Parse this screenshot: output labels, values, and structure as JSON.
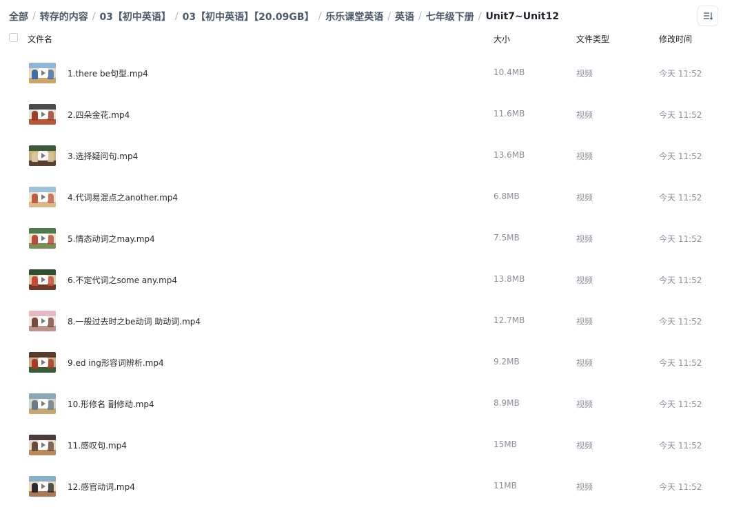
{
  "breadcrumb": [
    "全部",
    "转存的内容",
    "03【初中英语】",
    "03【初中英语】【20.09GB】",
    "乐乐课堂英语",
    "英语",
    "七年级下册",
    "Unit7~Unit12"
  ],
  "breadcrumb_separator": "/",
  "toolbar": {
    "sort_icon": "sort-list-icon"
  },
  "columns": {
    "name": "文件名",
    "size": "大小",
    "type": "文件类型",
    "time": "修改时间"
  },
  "files": [
    {
      "name": "1.there be句型.mp4",
      "size": "10.4MB",
      "type": "视频",
      "time": "今天 11:52",
      "thumb": {
        "top": "#8fb6d6",
        "mid": "#e9dcc0",
        "bot": "#c9a46e",
        "fig": "#3b6fa8"
      }
    },
    {
      "name": "2.四朵金花.mp4",
      "size": "11.6MB",
      "type": "视频",
      "time": "今天 11:52",
      "thumb": {
        "top": "#4a4a4a",
        "mid": "#e8e2d6",
        "bot": "#b85a3a",
        "fig": "#9b3d2a"
      }
    },
    {
      "name": "3.选择疑问句.mp4",
      "size": "13.6MB",
      "type": "视频",
      "time": "今天 11:52",
      "thumb": {
        "top": "#3a5a3a",
        "mid": "#c9b27a",
        "bot": "#5a4030",
        "fig": "#d8c7a0"
      }
    },
    {
      "name": "4.代词易混点之another.mp4",
      "size": "6.8MB",
      "type": "视频",
      "time": "今天 11:52",
      "thumb": {
        "top": "#9ec3d8",
        "mid": "#efe4cf",
        "bot": "#d9b98a",
        "fig": "#c25a48"
      }
    },
    {
      "name": "5.情态动词之may.mp4",
      "size": "7.5MB",
      "type": "视频",
      "time": "今天 11:52",
      "thumb": {
        "top": "#4f7a4f",
        "mid": "#ece3cf",
        "bot": "#7a8f5a",
        "fig": "#b94a3a"
      }
    },
    {
      "name": "6.不定代词之some any.mp4",
      "size": "13.8MB",
      "type": "视频",
      "time": "今天 11:52",
      "thumb": {
        "top": "#2f4f2f",
        "mid": "#d8cfa8",
        "bot": "#6a3a2a",
        "fig": "#c84a3a"
      }
    },
    {
      "name": "8.一般过去时之be动词 助动词.mp4",
      "size": "12.7MB",
      "type": "视频",
      "time": "今天 11:52",
      "thumb": {
        "top": "#e4b8c4",
        "mid": "#f2e8e0",
        "bot": "#b8948a",
        "fig": "#7a4a3a"
      }
    },
    {
      "name": "9.ed ing形容词辨析.mp4",
      "size": "9.2MB",
      "type": "视频",
      "time": "今天 11:52",
      "thumb": {
        "top": "#5a3a2a",
        "mid": "#c7b088",
        "bot": "#3a5a3a",
        "fig": "#a8382a"
      }
    },
    {
      "name": "10.形修名 副修动.mp4",
      "size": "8.9MB",
      "type": "视频",
      "time": "今天 11:52",
      "thumb": {
        "top": "#8aa8b8",
        "mid": "#d8d4c8",
        "bot": "#c4a878",
        "fig": "#6a7a8a"
      }
    },
    {
      "name": "11.感叹句.mp4",
      "size": "15MB",
      "type": "视频",
      "time": "今天 11:52",
      "thumb": {
        "top": "#4a3a3a",
        "mid": "#e6ddc8",
        "bot": "#b88a5a",
        "fig": "#6a4a3a"
      }
    },
    {
      "name": "12.感官动词.mp4",
      "size": "11MB",
      "type": "视频",
      "time": "今天 11:52",
      "thumb": {
        "top": "#8ab0c8",
        "mid": "#e8d8c0",
        "bot": "#a87a5a",
        "fig": "#2a2a2a"
      }
    }
  ]
}
